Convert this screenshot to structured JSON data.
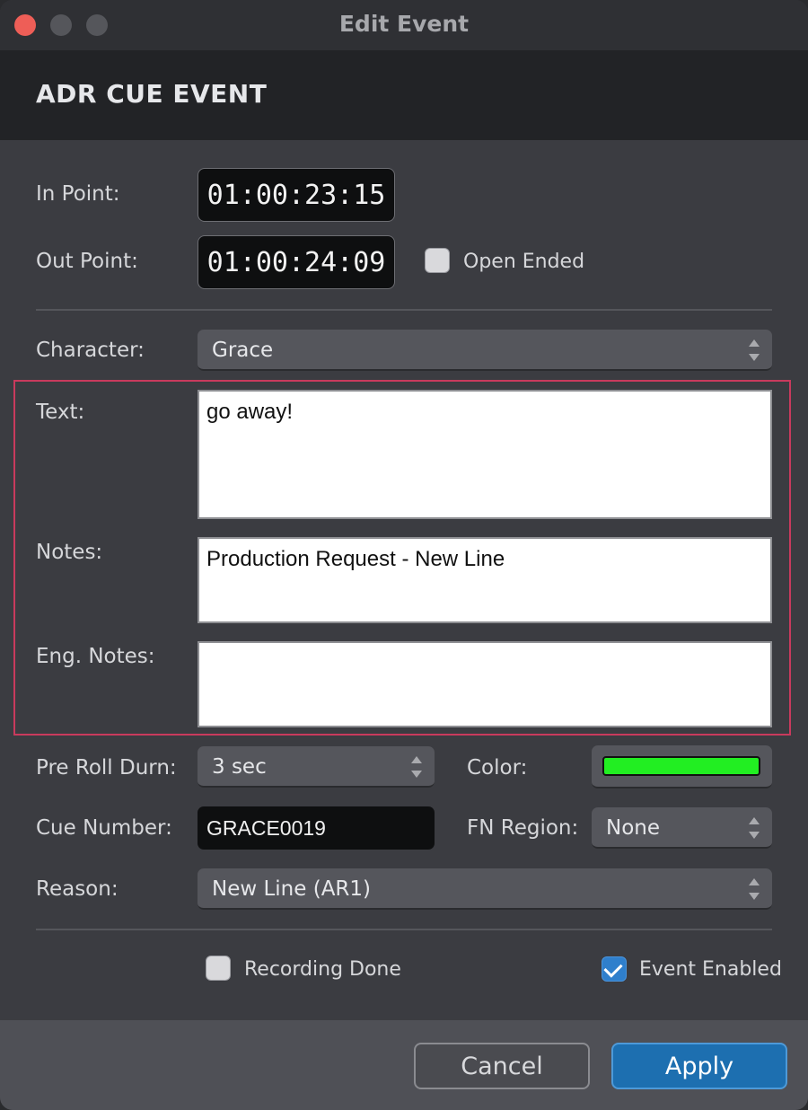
{
  "window": {
    "title": "Edit Event"
  },
  "header": {
    "title": "ADR CUE EVENT"
  },
  "timing": {
    "in_label": "In Point:",
    "in_value": "01:00:23:15",
    "out_label": "Out Point:",
    "out_value": "01:00:24:09",
    "open_ended_label": "Open Ended",
    "open_ended_checked": false
  },
  "character": {
    "label": "Character:",
    "value": "Grace"
  },
  "text": {
    "label": "Text:",
    "value": "go away!"
  },
  "notes": {
    "label": "Notes:",
    "value": "Production Request - New Line"
  },
  "eng_notes": {
    "label": "Eng. Notes:",
    "value": ""
  },
  "pre_roll": {
    "label": "Pre Roll Durn:",
    "value": "3 sec"
  },
  "color": {
    "label": "Color:",
    "value": "#22ee22"
  },
  "cue_number": {
    "label": "Cue Number:",
    "value": "GRACE0019"
  },
  "fn_region": {
    "label": "FN Region:",
    "value": "None"
  },
  "reason": {
    "label": "Reason:",
    "value": "New Line (AR1)"
  },
  "recording_done": {
    "label": "Recording Done",
    "checked": false
  },
  "event_enabled": {
    "label": "Event Enabled",
    "checked": true
  },
  "footer": {
    "cancel_label": "Cancel",
    "apply_label": "Apply"
  },
  "icons": {
    "close": "close-icon",
    "minimize": "minimize-icon",
    "zoom": "zoom-icon",
    "stepper": "stepper-arrows-icon",
    "check": "checkmark-icon"
  }
}
